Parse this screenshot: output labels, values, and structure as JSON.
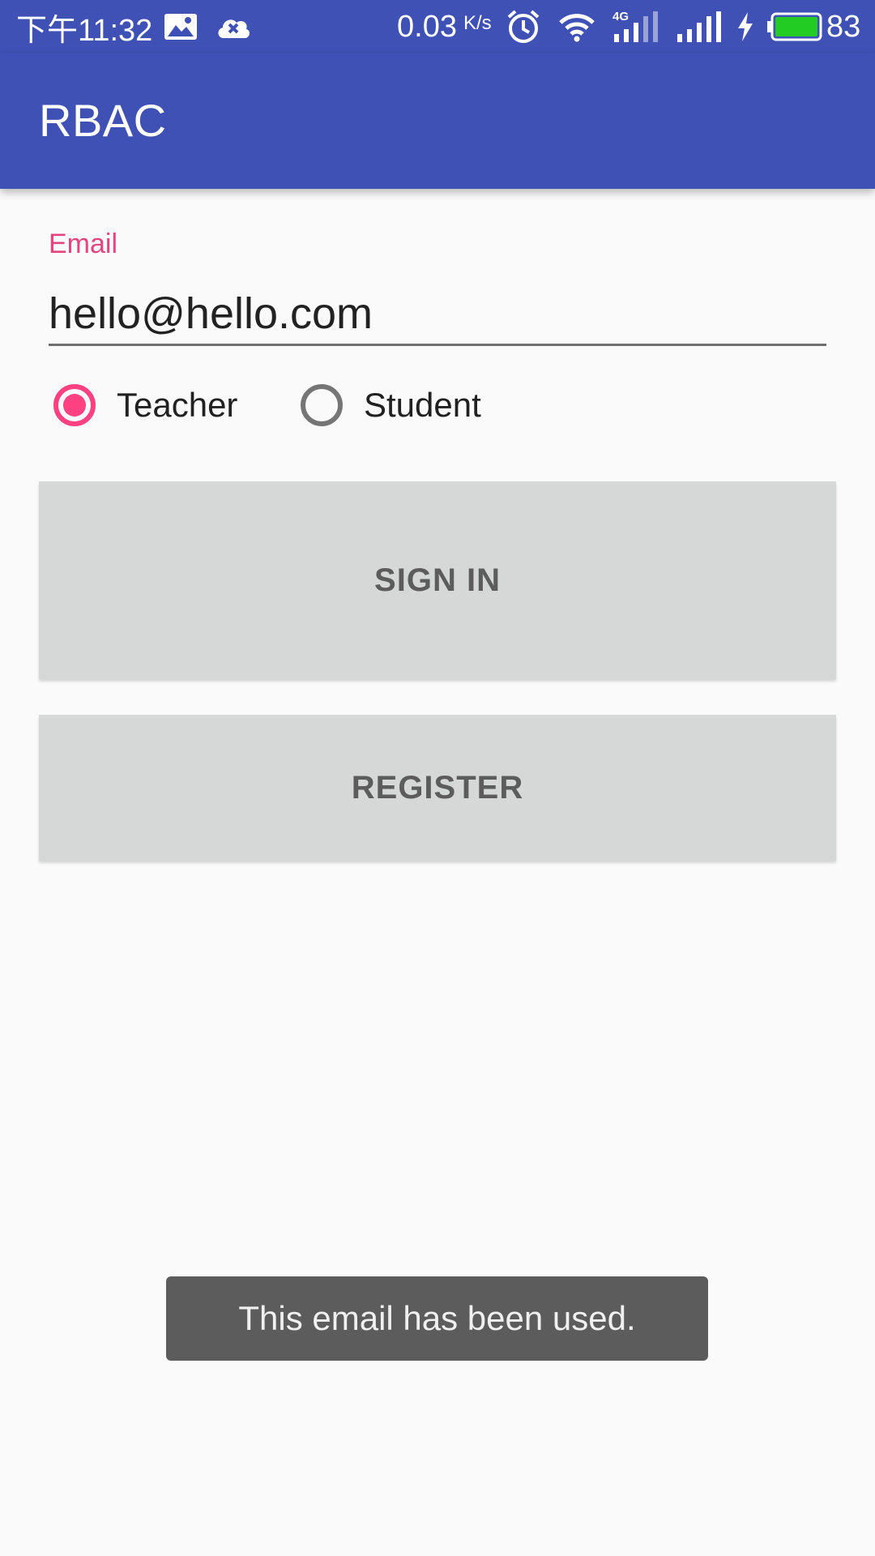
{
  "status_bar": {
    "time": "下午11:32",
    "speed": "0.03",
    "speed_unit": "K/s",
    "network_label": "4G",
    "battery_level": "83",
    "battery_fraction": 0.83,
    "icons": [
      "image-icon",
      "cloud-icon",
      "alarm-icon",
      "wifi-icon",
      "signal-icon",
      "charging-icon",
      "battery-icon"
    ]
  },
  "app_bar": {
    "title": "RBAC"
  },
  "form": {
    "email_label": "Email",
    "email_value": "hello@hello.com",
    "roles": [
      {
        "label": "Teacher",
        "checked": true
      },
      {
        "label": "Student",
        "checked": false
      }
    ],
    "sign_in_label": "SIGN IN",
    "register_label": "REGISTER"
  },
  "toast": {
    "message": "This email has been used."
  },
  "colors": {
    "primary": "#3f51b5",
    "accent": "#ff4081",
    "label": "#e5457d",
    "button_bg": "#d6d7d7",
    "toast_bg": "#5c5c5c",
    "battery_fill": "#22cc22"
  }
}
